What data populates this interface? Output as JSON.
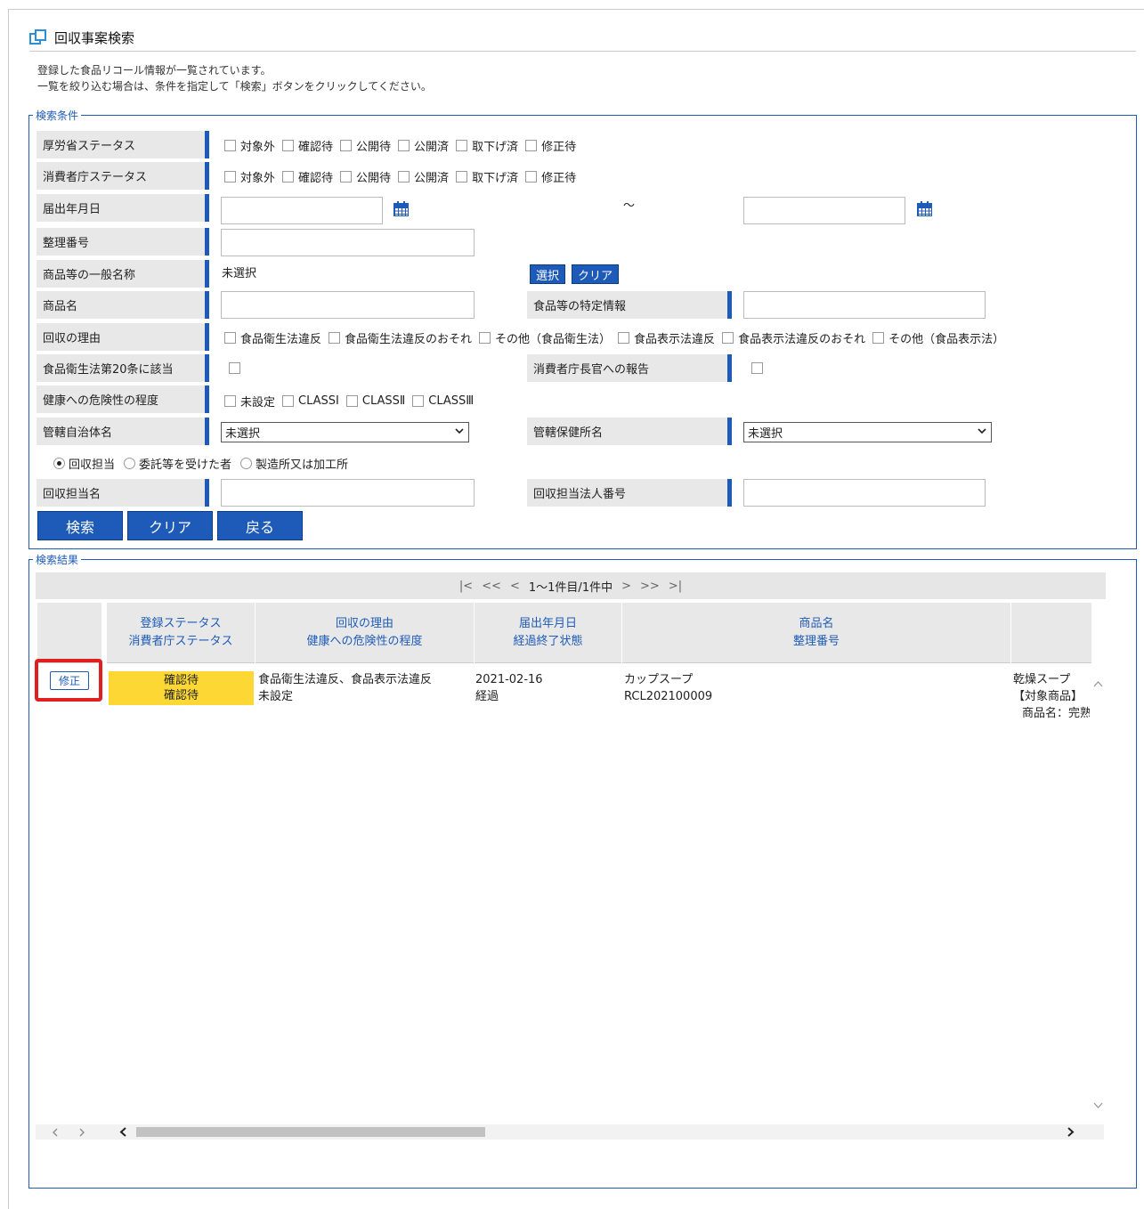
{
  "page": {
    "title": "回収事案検索",
    "desc_line1": "登録した食品リコール情報が一覧されています。",
    "desc_line2": "一覧を絞り込む場合は、条件を指定して「検索」ボタンをクリックしてください。"
  },
  "search": {
    "legend": "検索条件",
    "labels": {
      "mhlw_status": "厚労省ステータス",
      "caa_status": "消費者庁ステータス",
      "notif_date": "届出年月日",
      "ref_no": "整理番号",
      "generic_name": "商品等の一般名称",
      "product_name": "商品名",
      "food_specific": "食品等の特定情報",
      "reason": "回収の理由",
      "art20": "食品衛生法第20条に該当",
      "caa_report": "消費者庁長官への報告",
      "health_risk": "健康への危険性の程度",
      "municipality": "管轄自治体名",
      "health_center": "管轄保健所名",
      "recall_person": "回収担当名",
      "corp_no": "回収担当法人番号"
    },
    "status_options": [
      "対象外",
      "確認待",
      "公開待",
      "公開済",
      "取下げ済",
      "修正待"
    ],
    "date_sep": "～",
    "generic_value": "未選択",
    "select_btn": "選択",
    "clear_small_btn": "クリア",
    "reason_options": [
      "食品衛生法違反",
      "食品衛生法違反のおそれ",
      "その他（食品衛生法）",
      "食品表示法違反",
      "食品表示法違反のおそれ",
      "その他（食品表示法）"
    ],
    "risk_options": [
      "未設定",
      "CLASSⅠ",
      "CLASSⅡ",
      "CLASSⅢ"
    ],
    "municipality_value": "未選択",
    "health_center_value": "未選択",
    "radio_options": [
      "回収担当",
      "委託等を受けた者",
      "製造所又は加工所"
    ],
    "buttons": {
      "search": "検索",
      "clear": "クリア",
      "back": "戻る"
    }
  },
  "results": {
    "legend": "検索結果",
    "pager": {
      "first": "|<",
      "prev_page": "<<",
      "prev": "<",
      "info": "1～1件目/1件中",
      "next": ">",
      "next_page": ">>",
      "last": ">|"
    },
    "headers": [
      {
        "line1": "登録ステータス",
        "line2": "消費者庁ステータス"
      },
      {
        "line1": "回収の理由",
        "line2": "健康への危険性の程度"
      },
      {
        "line1": "届出年月日",
        "line2": "経過終了状態"
      },
      {
        "line1": "商品名",
        "line2": "整理番号"
      }
    ],
    "row": {
      "edit": "修正",
      "status1": "確認待",
      "status2": "確認待",
      "reason": "食品衛生法違反、食品表示法違反",
      "risk": "未設定",
      "date": "2021-02-16",
      "elapsed": "経過",
      "product": "カップスープ",
      "ref_no": "RCL202100009",
      "extra1": "乾燥スープ",
      "extra2": "【対象商品】",
      "extra3": "商品名：完熟"
    }
  },
  "colors": {
    "accent": "#1e5bb8",
    "highlight": "#fdd835",
    "alert": "#e02020"
  }
}
